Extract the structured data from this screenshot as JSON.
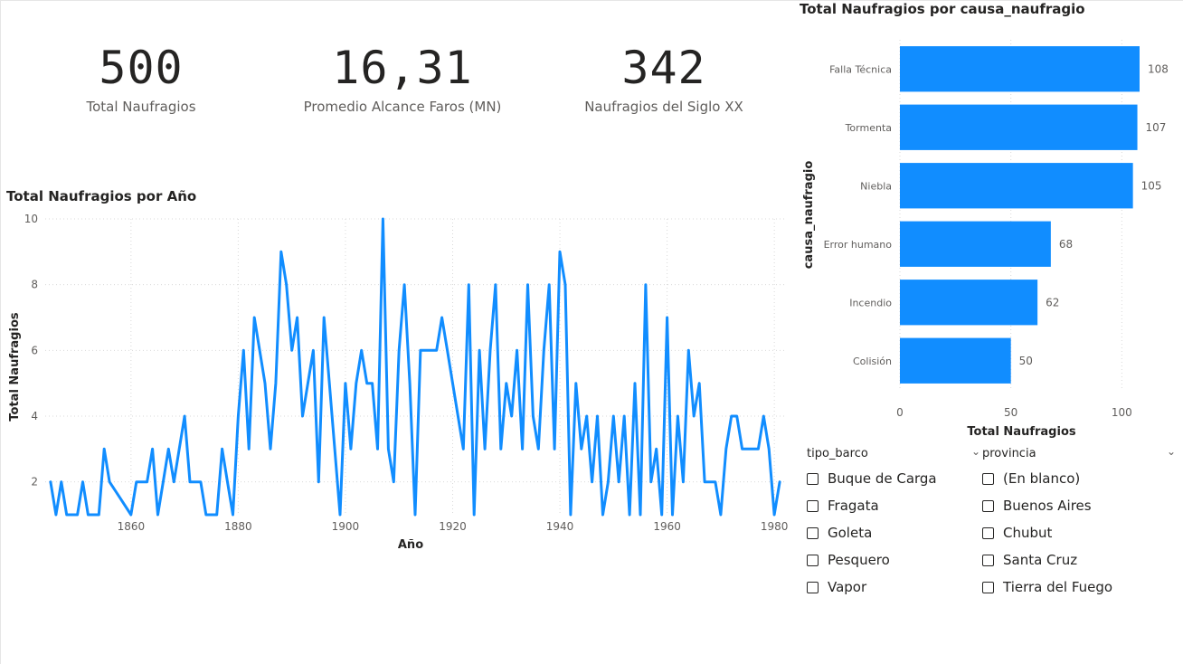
{
  "kpis": [
    {
      "value": "500",
      "label": "Total Naufragios"
    },
    {
      "value": "16,31",
      "label": "Promedio Alcance Faros (MN)"
    },
    {
      "value": "342",
      "label": "Naufragios del Siglo XX"
    }
  ],
  "chart_data": [
    {
      "type": "line",
      "title": "Total Naufragios por Año",
      "xlabel": "Año",
      "ylabel": "Total Naufragios",
      "xlim": [
        1844,
        1982
      ],
      "ylim": [
        1,
        10
      ],
      "x_ticks": [
        1860,
        1880,
        1900,
        1920,
        1940,
        1960,
        1980
      ],
      "y_ticks": [
        2,
        4,
        6,
        8,
        10
      ],
      "grid": true,
      "color": "#118dff",
      "x": [
        1845,
        1846,
        1847,
        1848,
        1849,
        1850,
        1851,
        1852,
        1853,
        1854,
        1855,
        1856,
        1858,
        1860,
        1861,
        1862,
        1863,
        1864,
        1865,
        1866,
        1867,
        1868,
        1869,
        1870,
        1871,
        1872,
        1873,
        1874,
        1875,
        1876,
        1877,
        1878,
        1879,
        1880,
        1881,
        1882,
        1883,
        1884,
        1885,
        1886,
        1887,
        1888,
        1889,
        1890,
        1891,
        1892,
        1893,
        1894,
        1895,
        1896,
        1897,
        1898,
        1899,
        1900,
        1901,
        1902,
        1903,
        1904,
        1905,
        1906,
        1907,
        1908,
        1909,
        1910,
        1911,
        1912,
        1913,
        1914,
        1915,
        1916,
        1917,
        1918,
        1919,
        1920,
        1921,
        1922,
        1923,
        1924,
        1925,
        1926,
        1927,
        1928,
        1929,
        1930,
        1931,
        1932,
        1933,
        1934,
        1935,
        1936,
        1937,
        1938,
        1939,
        1940,
        1941,
        1942,
        1943,
        1944,
        1945,
        1946,
        1947,
        1948,
        1949,
        1950,
        1951,
        1952,
        1953,
        1954,
        1955,
        1956,
        1957,
        1958,
        1959,
        1960,
        1961,
        1962,
        1963,
        1964,
        1965,
        1966,
        1967,
        1968,
        1969,
        1970,
        1971,
        1972,
        1973,
        1974,
        1975,
        1976,
        1977,
        1978,
        1979,
        1980,
        1981
      ],
      "y": [
        2,
        1,
        2,
        1,
        1,
        1,
        2,
        1,
        1,
        1,
        3,
        2,
        1.5,
        1,
        2,
        2,
        2,
        3,
        1,
        2,
        3,
        2,
        3,
        4,
        2,
        2,
        2,
        1,
        1,
        1,
        3,
        2,
        1,
        4,
        6,
        3,
        7,
        6,
        5,
        3,
        5,
        9,
        8,
        6,
        7,
        4,
        5,
        6,
        2,
        7,
        5,
        3,
        1,
        5,
        3,
        5,
        6,
        5,
        5,
        3,
        10,
        3,
        2,
        6,
        8,
        5,
        1,
        6,
        6,
        6,
        6,
        7,
        6,
        5,
        4,
        3,
        8,
        1,
        6,
        3,
        6,
        8,
        3,
        5,
        4,
        6,
        3,
        8,
        4,
        3,
        6,
        8,
        3,
        9,
        8,
        1,
        5,
        3,
        4,
        2,
        4,
        1,
        2,
        4,
        2,
        4,
        1,
        5,
        1,
        8,
        2,
        3,
        1,
        7,
        1,
        4,
        2,
        6,
        4,
        5,
        2,
        2,
        2,
        1,
        3,
        4,
        4,
        3,
        3,
        3,
        3,
        4,
        3,
        1,
        2,
        2,
        1
      ]
    },
    {
      "type": "bar",
      "orientation": "horizontal",
      "title": "Total Naufragios por causa_naufragio",
      "xlabel": "Total Naufragios",
      "ylabel": "causa_naufragio",
      "categories": [
        "Falla Técnica",
        "Tormenta",
        "Niebla",
        "Error humano",
        "Incendio",
        "Colisión"
      ],
      "values": [
        108,
        107,
        105,
        68,
        62,
        50
      ],
      "xlim": [
        0,
        108
      ],
      "x_ticks": [
        0,
        50,
        100
      ],
      "grid": true,
      "data_labels": true,
      "color": "#118dff"
    }
  ],
  "slicers": {
    "tipo_barco": {
      "title": "tipo_barco",
      "options": [
        "Buque de Carga",
        "Fragata",
        "Goleta",
        "Pesquero",
        "Vapor"
      ]
    },
    "provincia": {
      "title": "provincia",
      "options": [
        "(En blanco)",
        "Buenos Aires",
        "Chubut",
        "Santa Cruz",
        "Tierra del Fuego"
      ]
    }
  }
}
